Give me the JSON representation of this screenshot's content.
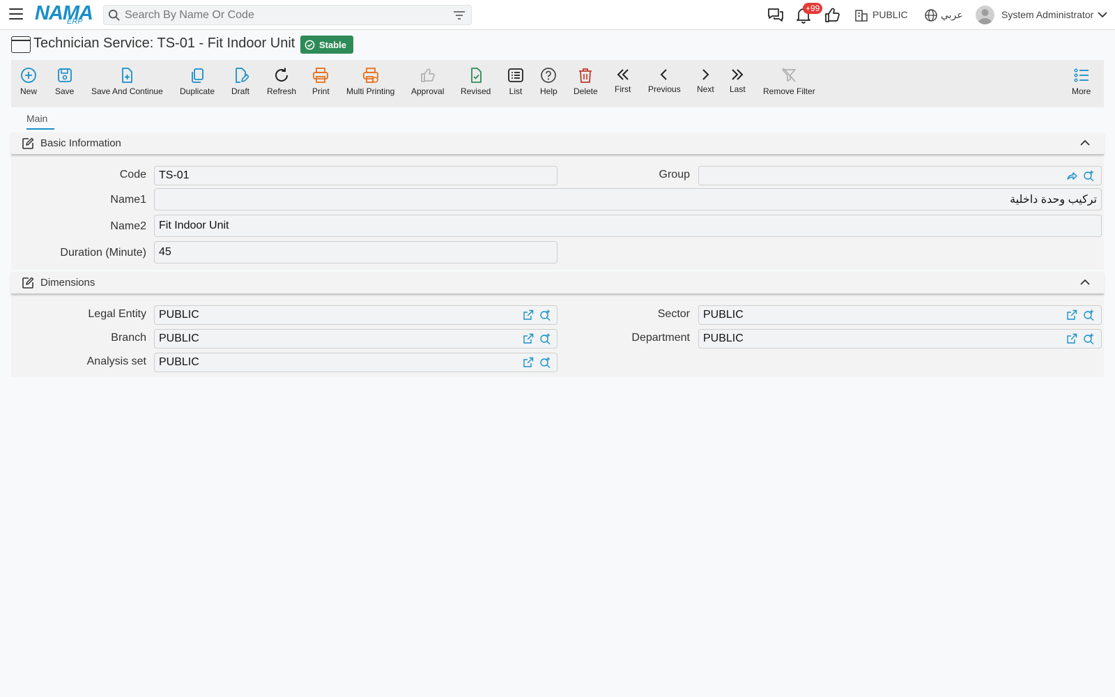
{
  "header": {
    "logo_main": "NAMA",
    "logo_sub": "ERP",
    "search_placeholder": "Search By Name Or Code",
    "notification_badge": "+99",
    "company": "PUBLIC",
    "language": "عربي",
    "user": "System Administrator"
  },
  "page": {
    "title": "Technician Service: TS-01 - Fit Indoor Unit",
    "status": "Stable"
  },
  "toolbar": {
    "new": "New",
    "save": "Save",
    "save_continue": "Save And Continue",
    "duplicate": "Duplicate",
    "draft": "Draft",
    "refresh": "Refresh",
    "print": "Print",
    "multi_printing": "Multi Printing",
    "approval": "Approval",
    "revised": "Revised",
    "list": "List",
    "help": "Help",
    "delete": "Delete",
    "first": "First",
    "previous": "Previous",
    "next": "Next",
    "last": "Last",
    "remove_filter": "Remove Filter",
    "more": "More"
  },
  "tabs": {
    "main": "Main"
  },
  "basic": {
    "title": "Basic Information",
    "code_label": "Code",
    "code_value": "TS-01",
    "group_label": "Group",
    "group_value": "",
    "name1_label": "Name1",
    "name1_value": "تركيب وحدة داخلية",
    "name2_label": "Name2",
    "name2_value": "Fit Indoor Unit",
    "duration_label": "Duration (Minute)",
    "duration_value": "45"
  },
  "dimensions": {
    "title": "Dimensions",
    "legal_entity_label": "Legal Entity",
    "legal_entity_value": "PUBLIC",
    "sector_label": "Sector",
    "sector_value": "PUBLIC",
    "branch_label": "Branch",
    "branch_value": "PUBLIC",
    "department_label": "Department",
    "department_value": "PUBLIC",
    "analysis_label": "Analysis set",
    "analysis_value": "PUBLIC"
  },
  "colors": {
    "accent": "#1a8fc9",
    "print": "#e8711c",
    "revised": "#2e8b57",
    "delete": "#c0392b",
    "status": "#2e8b57",
    "badge": "#e53935"
  }
}
